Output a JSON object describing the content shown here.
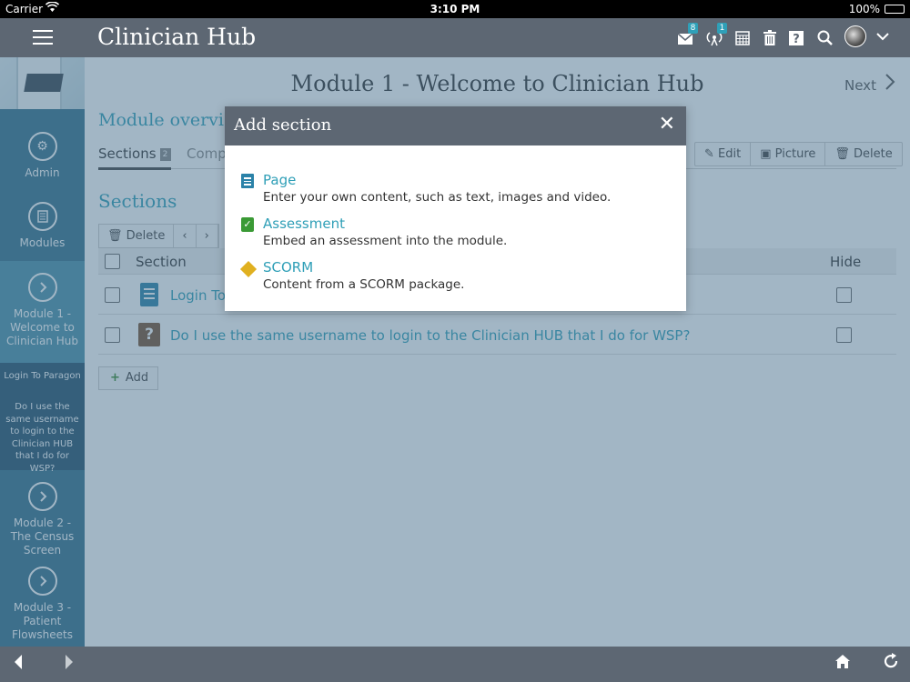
{
  "status_bar": {
    "carrier": "Carrier",
    "time": "3:10 PM",
    "battery": "100%"
  },
  "header": {
    "title": "Clinician Hub",
    "badges": {
      "inbox": "8",
      "broadcast": "1"
    }
  },
  "sidebar": {
    "items": [
      {
        "label": "Admin"
      },
      {
        "label": "Modules"
      }
    ],
    "modules": [
      {
        "label": "Module 1 - Welcome to Clinician Hub"
      },
      {
        "label": "Module 2 - The Census Screen"
      },
      {
        "label": "Module 3 - Patient Flowsheets"
      }
    ],
    "sub_items": [
      {
        "label": "Login To Paragon"
      },
      {
        "label": "Do I use the same username to login to the Clinician HUB that I do for WSP?"
      }
    ]
  },
  "main": {
    "module_title": "Module 1 - Welcome to Clinician Hub",
    "next_label": "Next",
    "overview_title": "Module overvi",
    "tabs": {
      "sections_label": "Sections",
      "sections_count": "2",
      "comp_label": "Comp"
    },
    "actions": {
      "edit": "Edit",
      "picture": "Picture",
      "delete": "Delete"
    },
    "sections_heading": "Sections",
    "toolbar": {
      "delete": "Delete"
    },
    "table": {
      "col_section": "Section",
      "col_hide": "Hide",
      "rows": [
        {
          "title": "Login To"
        },
        {
          "title": "Do I use the same username to login to the Clinician HUB that I do for WSP?"
        }
      ]
    },
    "add_label": "Add"
  },
  "modal": {
    "title": "Add section",
    "options": [
      {
        "label": "Page",
        "desc": "Enter your own content, such as text, images and video."
      },
      {
        "label": "Assessment",
        "desc": "Embed an assessment into the module."
      },
      {
        "label": "SCORM",
        "desc": "Content from a SCORM package."
      }
    ]
  },
  "colors": {
    "accent": "#2f9fb7",
    "header": "#5d6773",
    "sidebar": "#35708a"
  }
}
